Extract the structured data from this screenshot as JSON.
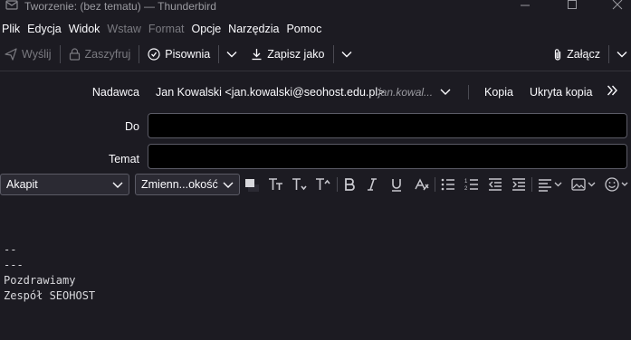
{
  "window": {
    "title": "Tworzenie: (bez tematu) — Thunderbird",
    "controls": [
      "minimize",
      "maximize",
      "close"
    ]
  },
  "menubar": {
    "items": [
      {
        "label": "Plik",
        "enabled": true
      },
      {
        "label": "Edycja",
        "enabled": true
      },
      {
        "label": "Widok",
        "enabled": true
      },
      {
        "label": "Wstaw",
        "enabled": false
      },
      {
        "label": "Format",
        "enabled": false
      },
      {
        "label": "Opcje",
        "enabled": true
      },
      {
        "label": "Narzędzia",
        "enabled": true
      },
      {
        "label": "Pomoc",
        "enabled": true
      }
    ]
  },
  "toolbar": {
    "send": "Wyślij",
    "encrypt": "Zaszyfruj",
    "spelling": "Pisownia",
    "save": "Zapisz jako",
    "attach": "Załącz"
  },
  "header": {
    "from_label": "Nadawca",
    "from_value": "Jan Kowalski <jan.kowalski@seohost.edu.pl>",
    "from_identity": "jan.kowal...",
    "cc": "Kopia",
    "bcc": "Ukryta kopia",
    "to_label": "Do",
    "to_value": "",
    "subject_label": "Temat",
    "subject_value": ""
  },
  "format": {
    "paragraph": "Akapit",
    "font": "Zmienn...okość"
  },
  "body": {
    "signature": "-- \n---\nPozdrawiamy\nZespół SEOHOST"
  },
  "colors": {
    "background": "#1c1b22",
    "field_bg": "#000000",
    "border": "#5b5b66"
  }
}
